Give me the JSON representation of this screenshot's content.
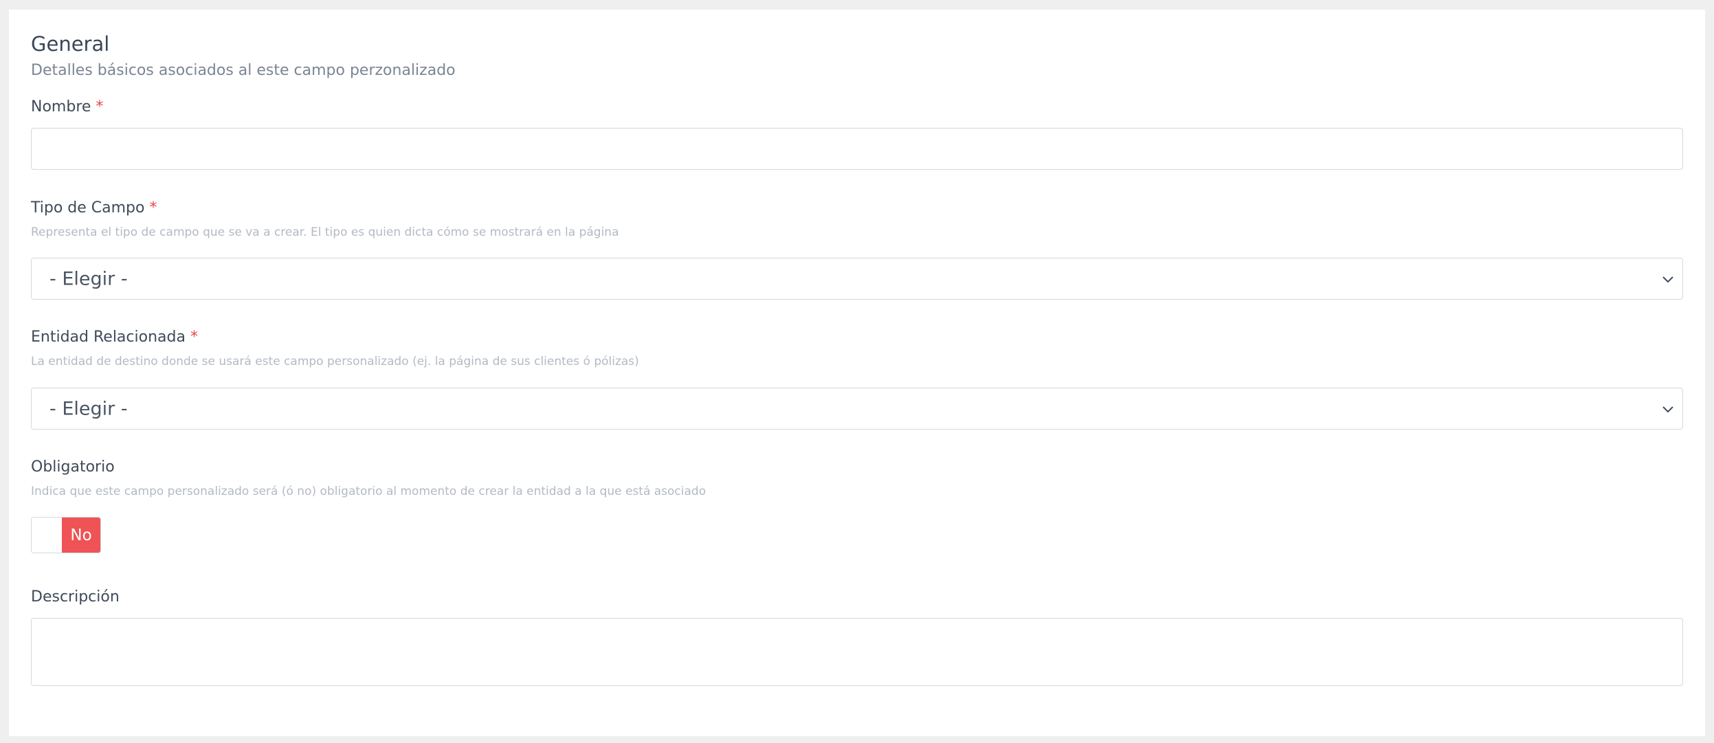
{
  "section": {
    "title": "General",
    "subtitle": "Detalles básicos asociados al este campo perzonalizado"
  },
  "fields": {
    "nombre": {
      "label": "Nombre",
      "required_mark": "*",
      "value": ""
    },
    "tipo_campo": {
      "label": "Tipo de Campo",
      "required_mark": "*",
      "help": "Representa el tipo de campo que se va a crear. El tipo es quien dicta cómo se mostrará en la página",
      "selected": "- Elegir -"
    },
    "entidad": {
      "label": "Entidad Relacionada",
      "required_mark": "*",
      "help": "La entidad de destino donde se usará este campo personalizado (ej. la página de sus clientes ó pólizas)",
      "selected": "- Elegir -"
    },
    "obligatorio": {
      "label": "Obligatorio",
      "help": "Indica que este campo personalizado será (ó no) obligatorio al momento de crear la entidad a la que está asociado",
      "toggle_off_label": "No",
      "toggle_color": "#ef5355"
    },
    "descripcion": {
      "label": "Descripción",
      "value": ""
    }
  },
  "icons": {
    "select_chevron": "chevron-down-icon"
  }
}
